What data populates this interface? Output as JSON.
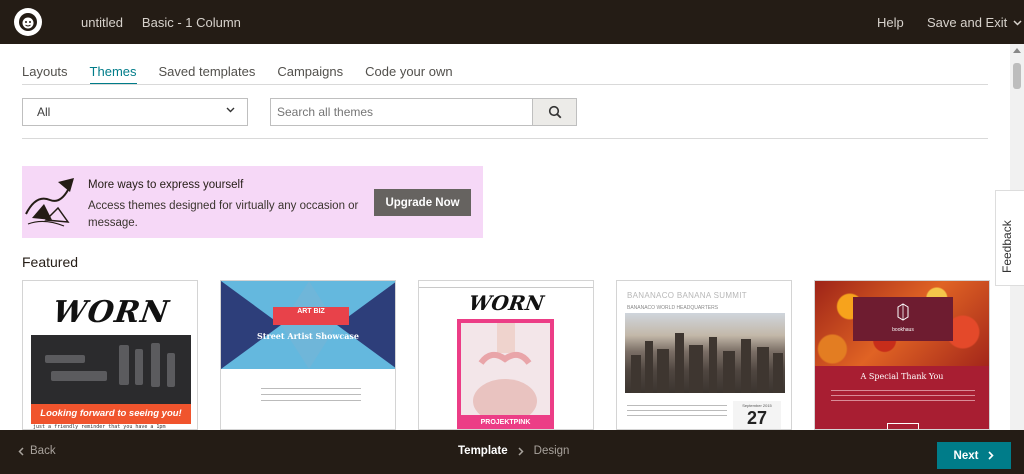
{
  "topbar": {
    "doc_title": "untitled",
    "template_name": "Basic - 1 Column",
    "help": "Help",
    "save_exit": "Save and Exit"
  },
  "tabs": [
    {
      "label": "Layouts",
      "active": false
    },
    {
      "label": "Themes",
      "active": true
    },
    {
      "label": "Saved templates",
      "active": false
    },
    {
      "label": "Campaigns",
      "active": false
    },
    {
      "label": "Code your own",
      "active": false
    }
  ],
  "filter": {
    "selected": "All"
  },
  "search": {
    "placeholder": "Search all themes",
    "value": ""
  },
  "promo": {
    "title": "More ways to express yourself",
    "description": "Access themes designed for virtually any occasion or message.",
    "button": "Upgrade Now"
  },
  "featured": {
    "heading": "Featured",
    "cards": [
      {
        "heading": "WORN",
        "tagline": "Looking forward to seeing you!",
        "footer": "just a friendly reminder that you have a 1pm"
      },
      {
        "logo": "ART BIZ",
        "subtitle": "Street Artist Showcase"
      },
      {
        "heading": "WORN",
        "label": "PROJEKTPINK"
      },
      {
        "title": "BANANACO BANANA SUMMIT",
        "subtitle": "BANANACO WORLD HEADQUARTERS",
        "cal_month": "September 2015",
        "cal_day": "27"
      },
      {
        "brand": "bookhaus",
        "heading": "A Special Thank You"
      }
    ]
  },
  "feedback": "Feedback",
  "bottombar": {
    "back": "Back",
    "step_current": "Template",
    "step_next": "Design",
    "next": "Next"
  },
  "colors": {
    "accent": "#007c89",
    "bar": "#241c15",
    "promo_bg": "#f6d8f7"
  }
}
